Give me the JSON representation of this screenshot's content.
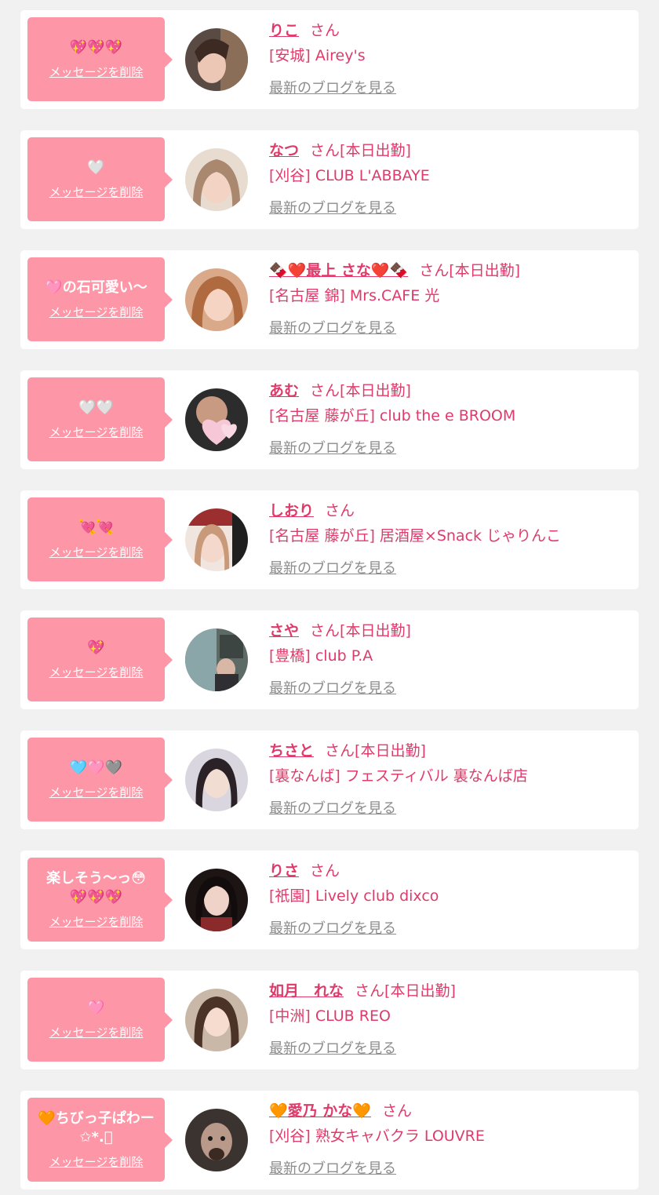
{
  "entries": [
    {
      "message": "💖💖💖",
      "delete_label": "メッセージを削除",
      "name": "りこ",
      "san": "さん",
      "status": "",
      "shop": "[安城] Airey's",
      "blog_label": "最新のブログを見る"
    },
    {
      "message": "🤍",
      "delete_label": "メッセージを削除",
      "name": "なつ",
      "san": "さん",
      "status": "[本日出勤]",
      "shop": "[刈谷] CLUB L'ABBAYE",
      "blog_label": "最新のブログを見る"
    },
    {
      "message": "🩷の石可愛い〜",
      "delete_label": "メッセージを削除",
      "name": "🍫❤️最上 さな❤️🍫",
      "san": "さん",
      "status": "[本日出勤]",
      "shop": "[名古屋 錦] Mrs.CAFE 光",
      "blog_label": "最新のブログを見る"
    },
    {
      "message": "🤍🤍",
      "delete_label": "メッセージを削除",
      "name": "あむ",
      "san": "さん",
      "status": "[本日出勤]",
      "shop": "[名古屋 藤が丘] club the e BROOM",
      "blog_label": "最新のブログを見る"
    },
    {
      "message": "💘💘",
      "delete_label": "メッセージを削除",
      "name": "しおり",
      "san": "さん",
      "status": "",
      "shop": "[名古屋 藤が丘] 居酒屋×Snack じゃりんこ",
      "blog_label": "最新のブログを見る"
    },
    {
      "message": "💖",
      "delete_label": "メッセージを削除",
      "name": "さや",
      "san": "さん",
      "status": "[本日出勤]",
      "shop": "[豊橋] club P.A",
      "blog_label": "最新のブログを見る"
    },
    {
      "message": "🩵🩷🩶",
      "delete_label": "メッセージを削除",
      "name": "ちさと",
      "san": "さん",
      "status": "[本日出勤]",
      "shop": "[裏なんば] フェスティバル 裏なんば店",
      "blog_label": "最新のブログを見る"
    },
    {
      "message": "楽しそう〜っ😳\n💖💖💖",
      "delete_label": "メッセージを削除",
      "name": "りさ",
      "san": "さん",
      "status": "",
      "shop": "[祇園] Lively club dixco",
      "blog_label": "最新のブログを見る"
    },
    {
      "message": "🩷",
      "delete_label": "メッセージを削除",
      "name": "如月　れな",
      "san": "さん",
      "status": "[本日出勤]",
      "shop": "[中洲] CLUB REO",
      "blog_label": "最新のブログを見る"
    },
    {
      "message": "🧡ちびっ子ぱわー\n✩*.ﾟ",
      "delete_label": "メッセージを削除",
      "name": "🧡愛乃 かな🧡",
      "san": "さん",
      "status": "",
      "shop": "[刈谷] 熟女キャバクラ LOUVRE",
      "blog_label": "最新のブログを見る"
    }
  ],
  "colors": {
    "page_bg": "#f1f1f1",
    "bubble_bg": "#fd96a6",
    "accent_pink": "#e03a6a",
    "link_gray": "#8c8c8c"
  }
}
